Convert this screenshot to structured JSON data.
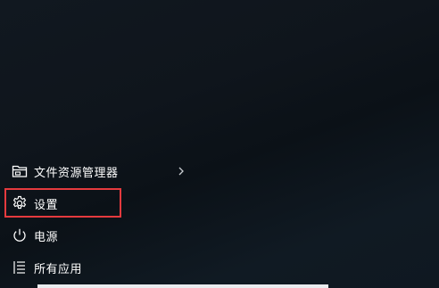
{
  "start_menu": {
    "items": [
      {
        "label": "文件资源管理器",
        "icon": "file-explorer-icon",
        "has_submenu": true
      },
      {
        "label": "设置",
        "icon": "gear-icon",
        "has_submenu": false
      },
      {
        "label": "电源",
        "icon": "power-icon",
        "has_submenu": false
      },
      {
        "label": "所有应用",
        "icon": "all-apps-list-icon",
        "has_submenu": false
      }
    ],
    "highlight_color": "#e53a3e",
    "text_color": "#ffffff"
  }
}
